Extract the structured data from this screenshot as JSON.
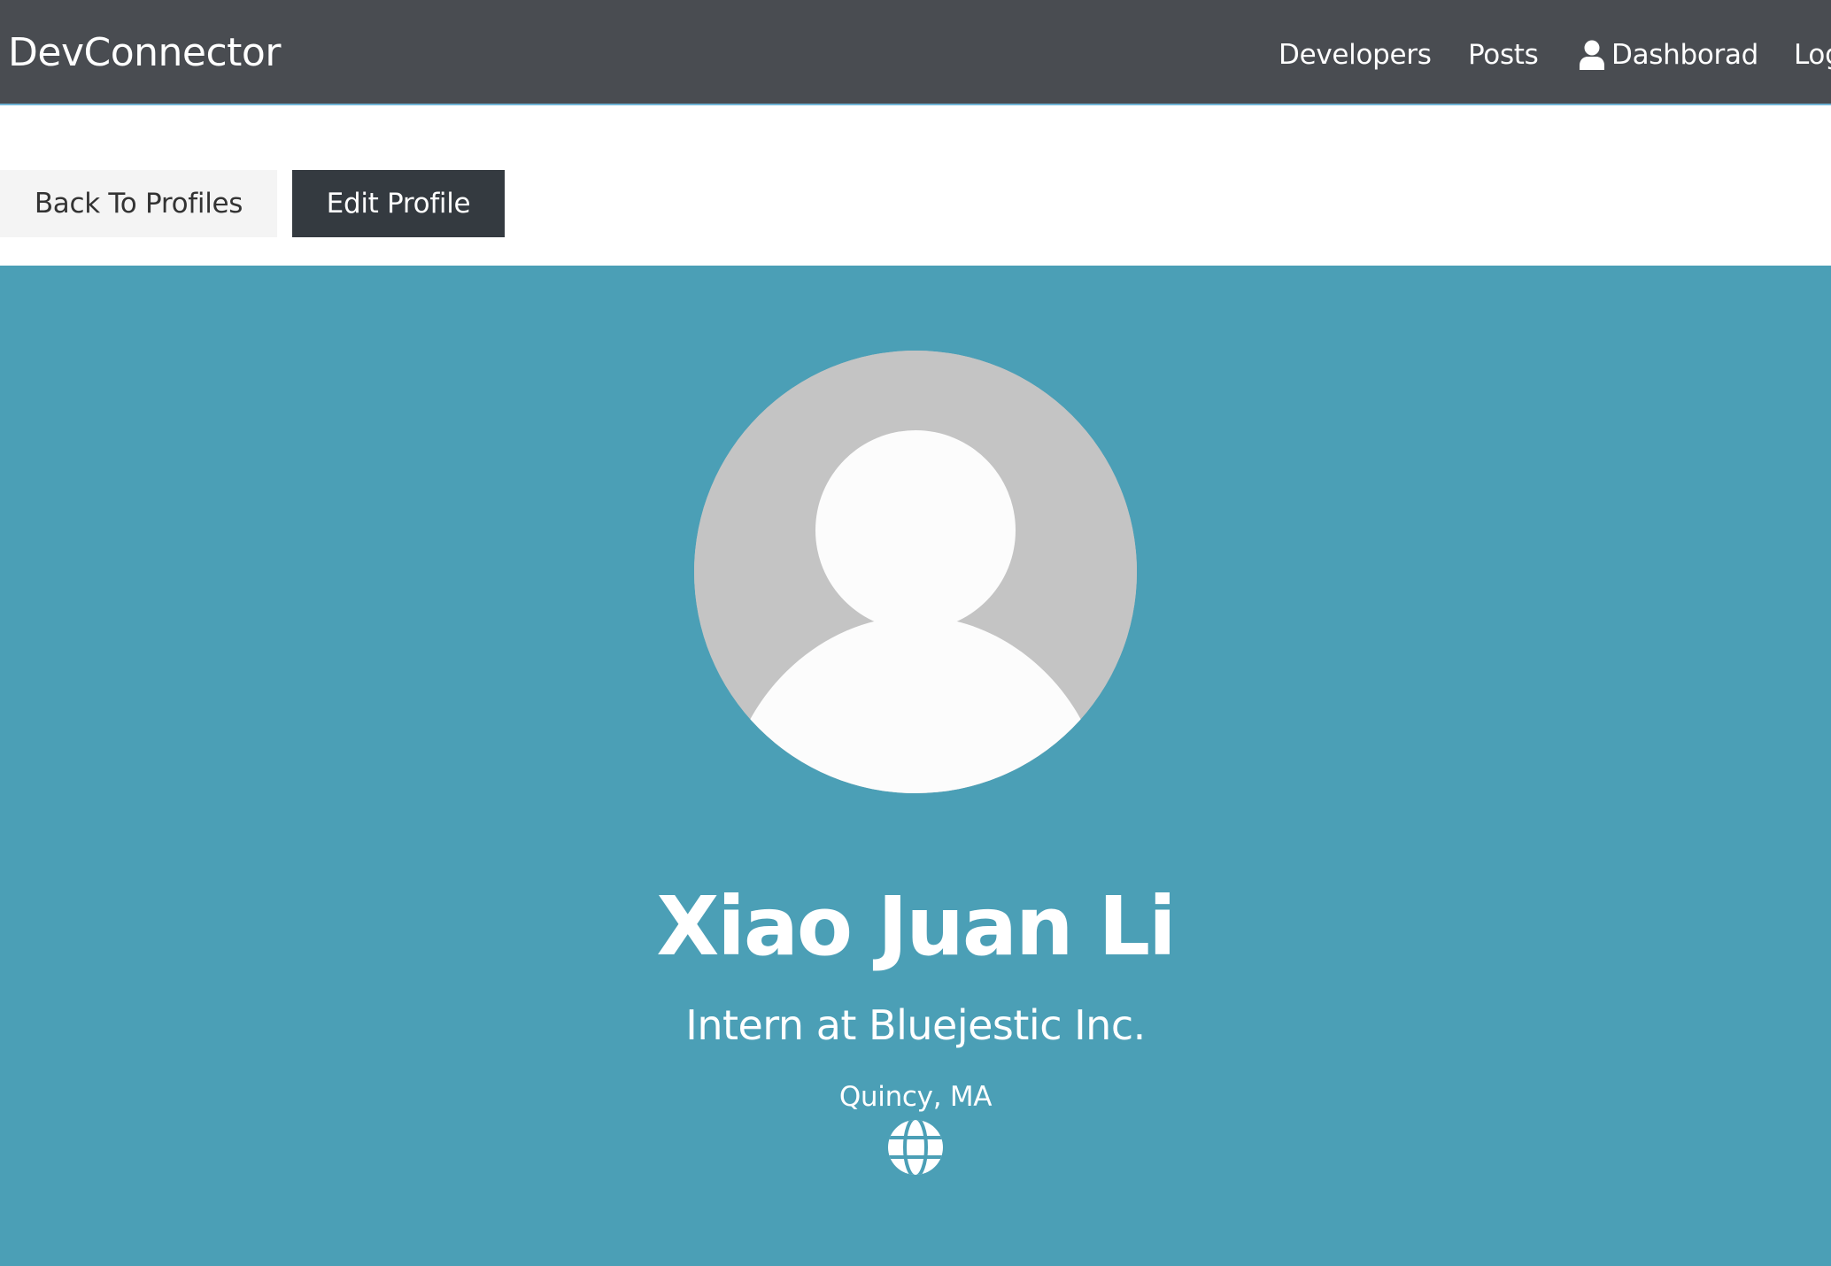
{
  "navbar": {
    "brand": "DevConnector",
    "links": {
      "developers": "Developers",
      "posts": "Posts",
      "dashboard": "Dashborad",
      "logout": "Log"
    },
    "dashboard_icon": "user-icon"
  },
  "actions": {
    "back_label": "Back To Profiles",
    "edit_label": "Edit Profile"
  },
  "profile": {
    "avatar_icon": "default-avatar",
    "name": "Xiao Juan Li",
    "status": "Intern at Bluejestic Inc.",
    "location": "Quincy, MA",
    "website_icon": "globe-icon"
  },
  "colors": {
    "navbar_bg": "#494c51",
    "primary": "#4b9fb6",
    "dark": "#343a40",
    "light": "#f4f4f4"
  }
}
